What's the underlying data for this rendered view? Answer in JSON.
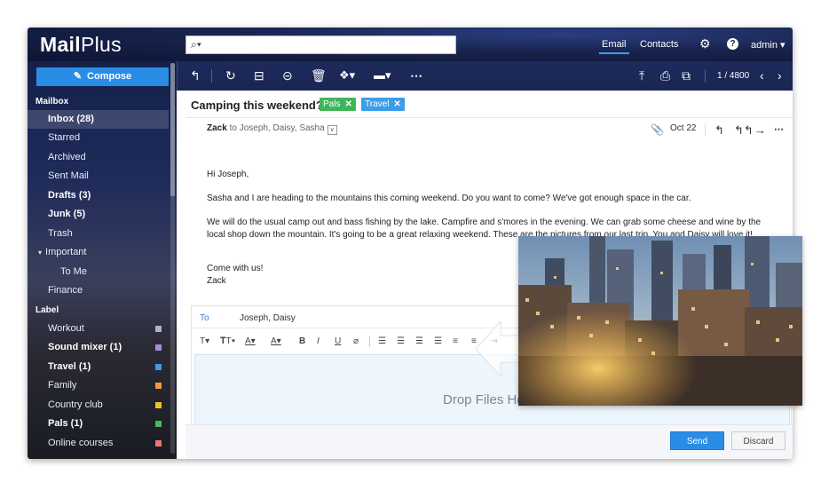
{
  "app": {
    "logo_main": "Mail",
    "logo_plus": "Plus"
  },
  "search": {
    "placeholder": ""
  },
  "topnav": {
    "email": "Email",
    "contacts": "Contacts",
    "user": "admin"
  },
  "compose_label": "Compose",
  "sidebar": {
    "mailbox_heading": "Mailbox",
    "items": [
      {
        "label": "Inbox (28)",
        "bold": true,
        "selected": true
      },
      {
        "label": "Starred"
      },
      {
        "label": "Archived"
      },
      {
        "label": "Sent Mail"
      },
      {
        "label": "Drafts (3)",
        "bold": true
      },
      {
        "label": "Junk (5)",
        "bold": true
      },
      {
        "label": "Trash"
      },
      {
        "label": "Important"
      },
      {
        "label": "To Me"
      },
      {
        "label": "Finance"
      }
    ],
    "label_heading": "Label",
    "labels": [
      {
        "label": "Workout",
        "color": "#aeb4bd"
      },
      {
        "label": "Sound mixer (1)",
        "bold": true,
        "color": "#a78bd8"
      },
      {
        "label": "Travel (1)",
        "bold": true,
        "color": "#3c9de9"
      },
      {
        "label": "Family",
        "color": "#f39a3c"
      },
      {
        "label": "Country club",
        "color": "#f5c024"
      },
      {
        "label": "Pals (1)",
        "bold": true,
        "color": "#49b85d"
      },
      {
        "label": "Online courses",
        "color": "#f07474"
      }
    ]
  },
  "toolbar": {
    "page": "1 / 4800"
  },
  "message": {
    "subject": "Camping this weekend?",
    "tags": [
      {
        "label": "Pals",
        "color": "#3fb55a"
      },
      {
        "label": "Travel",
        "color": "#3c9de9"
      }
    ],
    "sender": "Zack",
    "recipients": "to Joseph, Daisy, Sasha",
    "date": "Oct 22",
    "greeting": "Hi Joseph,",
    "para1": "Sasha and I are heading to the mountains this coming weekend. Do you want to come? We've got enough space in the car.",
    "para2": "We will do the usual camp out and bass fishing by the lake. Campfire and s'mores in the evening. We can grab some cheese and wine by the local shop down the mountain. It's going to be a great relaxing weekend. These are the pictures from our last trip. You and Daisy will love it!",
    "closing1": "Come with us!",
    "closing2": "Zack"
  },
  "reply": {
    "to_label": "To",
    "to_value": "Joseph, Daisy",
    "drop_text": "Drop Files Here",
    "more": "...",
    "send": "Send",
    "discard": "Discard"
  }
}
